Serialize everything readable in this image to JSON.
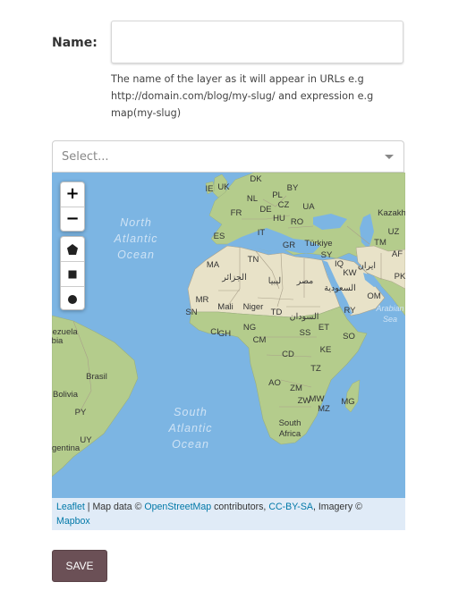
{
  "form": {
    "name_label": "Name:",
    "name_value": "",
    "help_text": "The name of the layer as it will appear in URLs e.g http://domain.com/blog/my-slug/ and expression e.g map(my-slug)",
    "select_placeholder": "Select...",
    "save_label": "SAVE"
  },
  "map": {
    "zoom_in": "+",
    "zoom_out": "−",
    "draw_tools": [
      "polygon-icon",
      "square-icon",
      "circle-icon"
    ],
    "oceans": {
      "north_atlantic": [
        "North",
        "Atlantic",
        "Ocean"
      ],
      "south_atlantic": [
        "South",
        "Atlantic",
        "Ocean"
      ],
      "arabian_sea": [
        "Arabian",
        "Sea"
      ]
    },
    "country_labels": [
      "IE",
      "UK",
      "DK",
      "NL",
      "PL",
      "FR",
      "DE",
      "CZ",
      "BY",
      "UA",
      "Kazakh",
      "HU",
      "RO",
      "ES",
      "IT",
      "GR",
      "Türkiye",
      "UZ",
      "TM",
      "AF",
      "MA",
      "TN",
      "SY",
      "IQ",
      "ایران",
      "PK",
      "الجزائر",
      "ليبيا",
      "مصر",
      "KW",
      "السعودية",
      "OM",
      "MR",
      "Mali",
      "Niger",
      "TD",
      "السودان",
      "RY",
      "SN",
      "CI",
      "GH",
      "NG",
      "CM",
      "SS",
      "ET",
      "SO",
      "KE",
      "CD",
      "TZ",
      "AO",
      "ZM",
      "MW",
      "ZW",
      "MZ",
      "MG",
      "South",
      "Africa",
      "nezuela",
      "bia",
      "Brasil",
      "Bolivia",
      "PY",
      "UY",
      "rgentina"
    ],
    "attribution": {
      "leaflet": "Leaflet",
      "map_data": " | Map data © ",
      "osm": "OpenStreetMap",
      "contributors": " contributors, ",
      "license": "CC-BY-SA",
      "imagery": ", Imagery ©",
      "mapbox": "Mapbox"
    }
  },
  "colors": {
    "ocean": "#7cb5e3",
    "land_green": "#b4cc8c",
    "desert": "#e8e2c8",
    "save_button": "#6b5056"
  }
}
